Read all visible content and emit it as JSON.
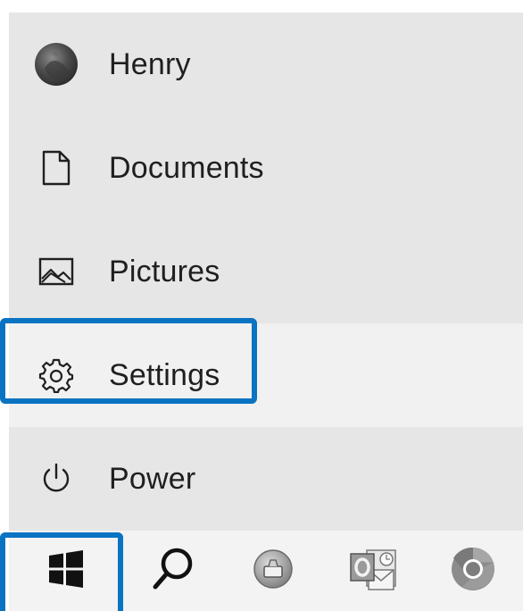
{
  "start_menu": {
    "user": {
      "label": "Henry",
      "icon": "user-avatar-icon"
    },
    "items": [
      {
        "label": "Documents",
        "icon": "document-icon"
      },
      {
        "label": "Pictures",
        "icon": "picture-icon"
      },
      {
        "label": "Settings",
        "icon": "gear-icon",
        "highlighted": true
      },
      {
        "label": "Power",
        "icon": "power-icon"
      }
    ]
  },
  "taskbar": {
    "buttons": [
      {
        "icon": "windows-logo-icon",
        "highlighted": true
      },
      {
        "icon": "search-icon"
      },
      {
        "icon": "disk-cleanup-app-icon"
      },
      {
        "icon": "outlook-app-icon"
      },
      {
        "icon": "chrome-app-icon"
      }
    ]
  },
  "colors": {
    "highlight_border": "#0a73c2",
    "menu_bg": "#e6e6e6",
    "menu_hover_bg": "#f1f1f1",
    "taskbar_bg": "#f3f3f3"
  }
}
